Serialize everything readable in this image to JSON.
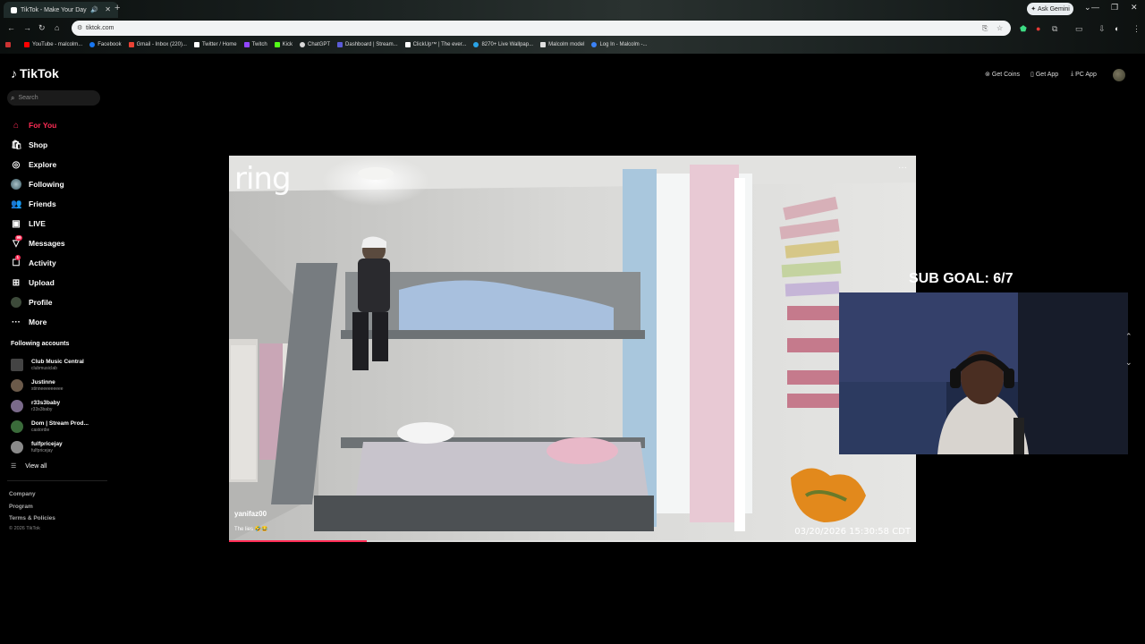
{
  "browser": {
    "tab_title": "TikTok - Make Your Day",
    "new_tab": "+",
    "url": "tiktok.com",
    "ask_gemini": "Ask Gemini",
    "bookmarks": [
      {
        "label": "YouTube - malcolm...",
        "color": "#ff0000"
      },
      {
        "label": "Facebook",
        "color": "#1877f2"
      },
      {
        "label": "Gmail - Inbox (220)...",
        "color": "#ea4335"
      },
      {
        "label": "Twitter / Home",
        "color": "#ffffff"
      },
      {
        "label": "Twitch",
        "color": "#9146ff"
      },
      {
        "label": "Kick",
        "color": "#53fc18"
      },
      {
        "label": "ChatGPT",
        "color": "#d9d9d9"
      },
      {
        "label": "Dashboard | Stream...",
        "color": "#5b5bd6"
      },
      {
        "label": "ClickUp™ | The ever...",
        "color": "#ffffff"
      },
      {
        "label": "8270+ Live Wallpap...",
        "color": "#2aa4e8"
      },
      {
        "label": "Malcolm model",
        "color": "#e0e0e0"
      },
      {
        "label": "Log In - Malcolm -...",
        "color": "#3b82f6"
      }
    ]
  },
  "tiktok": {
    "logo": "TikTok",
    "search_placeholder": "Search",
    "nav": [
      {
        "label": "For You",
        "icon": "home-icon",
        "active": true
      },
      {
        "label": "Shop",
        "icon": "shop-icon"
      },
      {
        "label": "Explore",
        "icon": "compass-icon"
      },
      {
        "label": "Following",
        "icon": "following-icon"
      },
      {
        "label": "Friends",
        "icon": "friends-icon"
      },
      {
        "label": "LIVE",
        "icon": "live-icon"
      },
      {
        "label": "Messages",
        "icon": "messages-icon",
        "badge": "99"
      },
      {
        "label": "Activity",
        "icon": "activity-icon",
        "badge": "1"
      },
      {
        "label": "Upload",
        "icon": "upload-icon"
      },
      {
        "label": "Profile",
        "icon": "profile-icon"
      },
      {
        "label": "More",
        "icon": "more-icon"
      }
    ],
    "following_title": "Following accounts",
    "accounts": [
      {
        "name": "Club Music Central",
        "handle": "clubmusiclab",
        "color": "#444"
      },
      {
        "name": "Justinne",
        "handle": "stinneeeeeeeee",
        "color": "#6b5a4a"
      },
      {
        "name": "r33s3baby",
        "handle": "r33s3baby",
        "color": "#7a6a8a"
      },
      {
        "name": "Dom | Stream Prod...",
        "handle": "castordie",
        "color": "#3a6b3a"
      },
      {
        "name": "fulfpricejay",
        "handle": "fulfpricejay",
        "color": "#8a8a8a"
      }
    ],
    "view_all": "View all",
    "footer": [
      "Company",
      "Program",
      "Terms & Policies"
    ],
    "copyright": "© 2026 TikTok",
    "top_actions": [
      "Get Coins",
      "Get App",
      "PC App"
    ]
  },
  "video": {
    "watermark": "ring",
    "username": "yanifaz00",
    "caption": "The lies 🤣😂",
    "timestamp": "03/20/2026 15:30:58 CDT",
    "progress": 0.2
  },
  "overlay": {
    "sub_goal": "SUB GOAL: 6/7"
  }
}
